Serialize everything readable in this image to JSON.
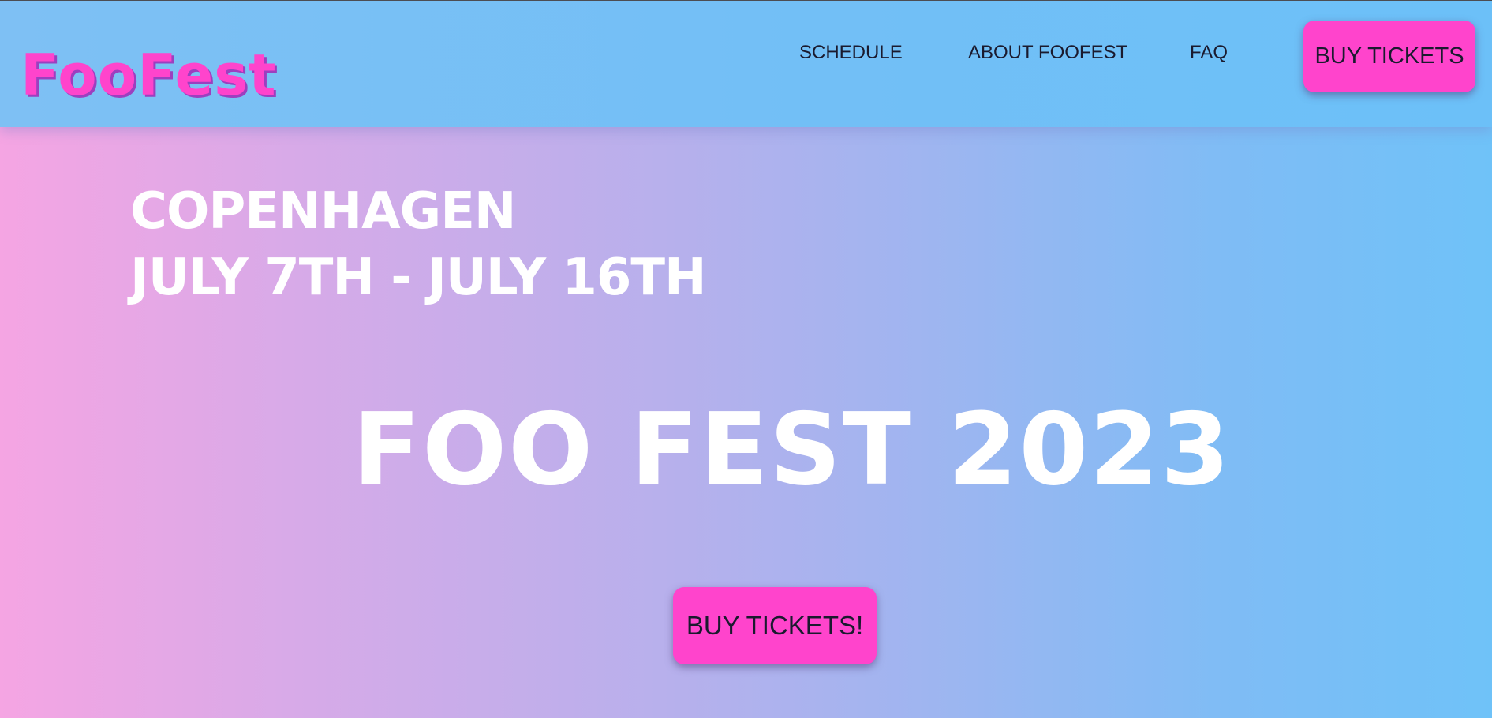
{
  "header": {
    "logo_text": "FooFest",
    "nav": {
      "schedule": "SCHEDULE",
      "about": "ABOUT FOOFEST",
      "faq": "FAQ"
    },
    "buy_button_label": "BUY TICKETS"
  },
  "hero": {
    "city": "COPENHAGEN",
    "dates": "JULY 7TH - JULY 16TH",
    "title": "FOO FEST 2023",
    "cta_label": "BUY TICKETS!"
  },
  "colors": {
    "accent": "#ff44cc",
    "navbar": "#72bff6",
    "gradient_left": "#f5a5e3",
    "gradient_right": "#6fc2f8",
    "text_dark": "#1a1a2e",
    "text_light": "#ffffff"
  }
}
